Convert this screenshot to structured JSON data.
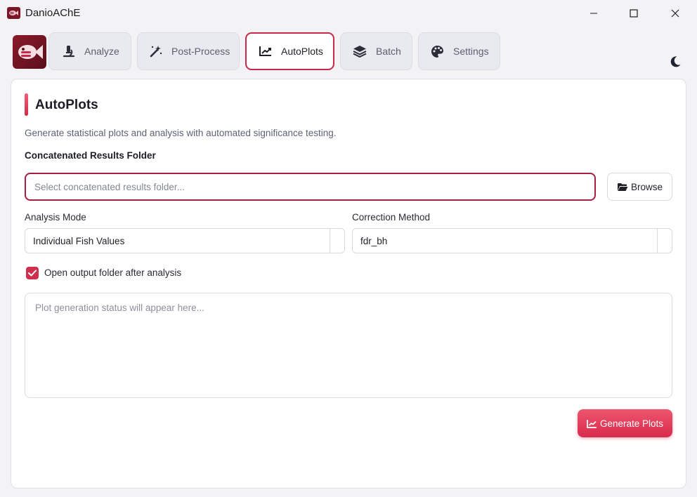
{
  "window": {
    "title": "DanioAChE",
    "controls": [
      "minimize-icon",
      "maximize-icon",
      "close-icon"
    ]
  },
  "nav": {
    "logo_icon": "fish-logo-icon",
    "tabs": [
      {
        "label": "Analyze",
        "icon": "microscope-icon",
        "active": false
      },
      {
        "label": "Post-Process",
        "icon": "magic-wand-icon",
        "active": false
      },
      {
        "label": "AutoPlots",
        "icon": "chart-line-icon",
        "active": true
      },
      {
        "label": "Batch",
        "icon": "layers-icon",
        "active": false
      },
      {
        "label": "Settings",
        "icon": "palette-icon",
        "active": false
      }
    ],
    "theme_toggle_icon": "moon-icon"
  },
  "page": {
    "title": "AutoPlots",
    "description": "Generate statistical plots and analysis with automated significance testing.",
    "folder_label": "Concatenated Results Folder",
    "folder_input": {
      "value": "",
      "placeholder": "Select concatenated results folder..."
    },
    "browse_label": "Browse",
    "analysis_mode": {
      "label": "Analysis Mode",
      "value": "Individual Fish Values"
    },
    "correction_method": {
      "label": "Correction Method",
      "value": "fdr_bh"
    },
    "open_output": {
      "label": "Open output folder after analysis",
      "checked": true
    },
    "status_placeholder": "Plot generation status will appear here...",
    "generate_label": "Generate Plots"
  },
  "colors": {
    "accent": "#d5284b",
    "accent_dark": "#a5203f",
    "background": "#f3f3f6",
    "card": "#ffffff"
  }
}
